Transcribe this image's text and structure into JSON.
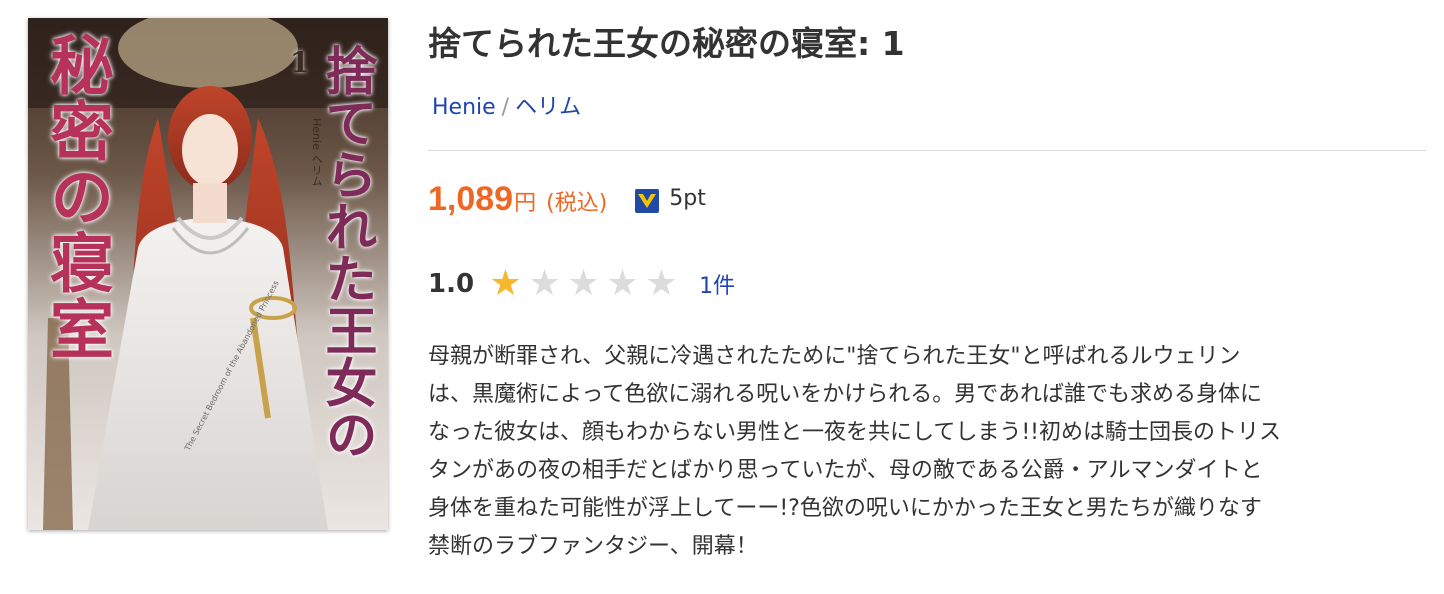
{
  "book": {
    "title": "捨てられた王女の秘密の寝室: 1",
    "cover": {
      "title_line_1": "秘密の寝室",
      "title_line_2": "捨てられた王女の",
      "volume": "1",
      "author_credit": "Henie ヘリム",
      "english_subtitle": "The Secret Bedroom of the Abandoned Princess"
    },
    "authors": [
      {
        "name": "Henie"
      },
      {
        "name": "ヘリム"
      }
    ],
    "author_separator": "/",
    "price": {
      "amount": "1,089",
      "currency": "円",
      "tax_note": "(税込)",
      "points": "5pt"
    },
    "rating": {
      "value": "1.0",
      "stars": 1.0,
      "max_stars": 5,
      "review_count": "1件"
    },
    "description_lines": [
      "母親が断罪され、父親に冷遇されたために\"捨てられた王女\"と呼ばれるルウェリン",
      "は、黒魔術によって色欲に溺れる呪いをかけられる。男であれば誰でも求める身体に",
      "なった彼女は、顔もわからない男性と一夜を共にしてしまう!!初めは騎士団長のトリス",
      "タンがあの夜の相手だとばかり思っていたが、母の敵である公爵・アルマンダイトと",
      "身体を重ねた可能性が浮上してーー!?色欲の呪いにかかった王女と男たちが織りなす",
      "禁断のラブファンタジー、開幕！"
    ]
  },
  "colors": {
    "price": "#f06723",
    "link": "#1f46b0",
    "star_on": "#f5b82e",
    "star_off": "#dcdcdc",
    "point_icon_bg": "#2049a8",
    "point_icon_fg": "#f5c400"
  },
  "icons": {
    "point": "v-point-icon",
    "star": "star-icon"
  }
}
